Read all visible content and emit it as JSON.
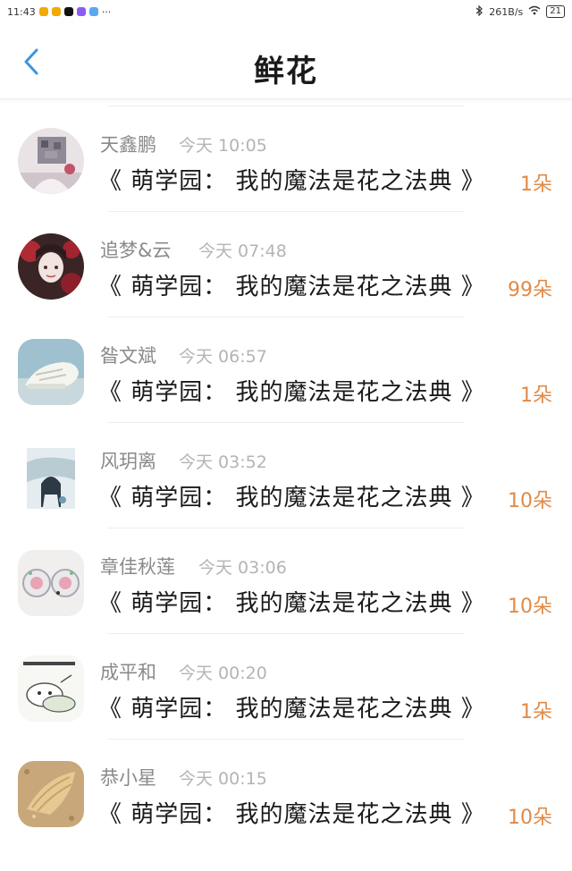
{
  "status_bar": {
    "time": "11:43",
    "extra": "···",
    "net_speed": "261B/s",
    "battery": "21"
  },
  "header": {
    "title": "鲜花"
  },
  "items": [
    {
      "name": "天鑫鹏",
      "time": "今天 10:05",
      "book": "《 萌学园： 我的魔法是花之法典 》",
      "quantity": "1朵",
      "avatar": "avatar-person-photo"
    },
    {
      "name": "追梦&云",
      "time": "今天 07:48",
      "book": "《 萌学园： 我的魔法是花之法典 》",
      "quantity": "99朵",
      "avatar": "avatar-anime-girl"
    },
    {
      "name": "昝文斌",
      "time": "今天 06:57",
      "book": "《 萌学园： 我的魔法是花之法典 》",
      "quantity": "1朵",
      "avatar": "avatar-sneaker"
    },
    {
      "name": "风玥离",
      "time": "今天 03:52",
      "book": "《 萌学园： 我的魔法是花之法典 》",
      "quantity": "10朵",
      "avatar": "avatar-ink-painting"
    },
    {
      "name": "章佳秋莲",
      "time": "今天 03:06",
      "book": "《 萌学园： 我的魔法是花之法典 》",
      "quantity": "10朵",
      "avatar": "avatar-earrings"
    },
    {
      "name": "成平和",
      "time": "今天 00:20",
      "book": "《 萌学园： 我的魔法是花之法典 》",
      "quantity": "1朵",
      "avatar": "avatar-cartoon-sleeping"
    },
    {
      "name": "恭小星",
      "time": "今天 00:15",
      "book": "《 萌学园： 我的魔法是花之法典 》",
      "quantity": "10朵",
      "avatar": "avatar-seashell"
    }
  ],
  "colors": {
    "accent_blue": "#3d95e0",
    "quantity_orange": "#e08a47"
  }
}
